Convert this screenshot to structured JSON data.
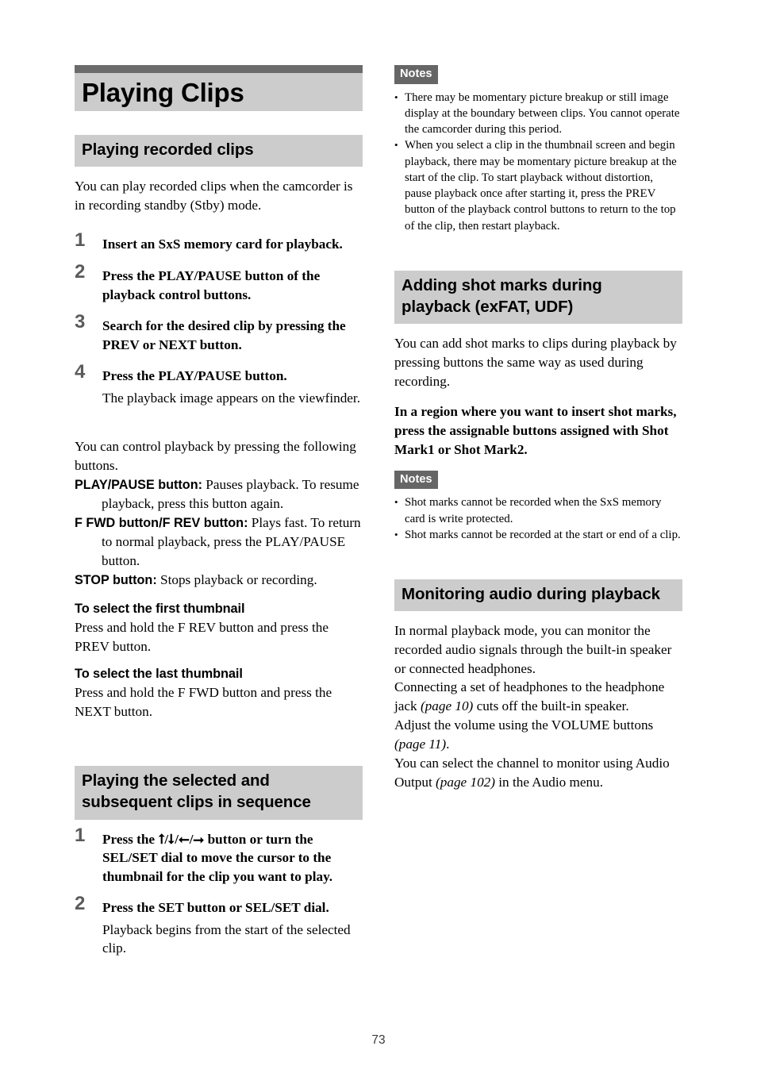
{
  "document": {
    "page_number": "73"
  },
  "chapter": {
    "title": "Playing Clips"
  },
  "left_column": {
    "section1": {
      "heading": "Playing recorded clips",
      "intro": "You can play recorded clips when the camcorder is in recording standby (Stby) mode.",
      "steps": [
        {
          "number": "1",
          "title": "Insert an SxS memory card for playback.",
          "detail": ""
        },
        {
          "number": "2",
          "title": "Press the PLAY/PAUSE button of the playback control buttons.",
          "detail": ""
        },
        {
          "number": "3",
          "title": "Search for the desired clip by pressing the PREV or NEXT button.",
          "detail": ""
        },
        {
          "number": "4",
          "title": "Press the PLAY/PAUSE button.",
          "detail": "The playback image appears on the viewfinder."
        }
      ],
      "control_intro": "You can control playback by pressing the following buttons.",
      "controls": [
        {
          "term": "PLAY/PAUSE button:",
          "desc": " Pauses playback. To resume playback, press this button again."
        },
        {
          "term": "F FWD button/F REV button:",
          "desc": " Plays fast. To return to normal playback, press the PLAY/PAUSE button."
        },
        {
          "term": "STOP button:",
          "desc": " Stops playback or recording."
        }
      ],
      "subheads": [
        {
          "title": "To select the first thumbnail",
          "body": "Press and hold the F REV button and press the PREV button."
        },
        {
          "title": "To select the last thumbnail",
          "body": "Press and hold the F FWD button and press the NEXT button."
        }
      ]
    },
    "section2": {
      "heading": "Playing the selected and subsequent clips in sequence",
      "steps": [
        {
          "number": "1",
          "title": "Press the ⭡/⭣/⭠/⭢ button or turn the SEL/SET dial to move the cursor to the thumbnail for the clip you want to play.",
          "detail": ""
        },
        {
          "number": "2",
          "title": "Press the SET button or SEL/SET dial.",
          "detail": "Playback begins from the start of the selected clip."
        }
      ]
    }
  },
  "right_column": {
    "notes1": {
      "badge": "Notes",
      "items": [
        "There may be momentary picture breakup or still image display at the boundary between clips. You cannot operate the camcorder during this period.",
        "When you select a clip in the thumbnail screen and begin playback, there may be momentary picture breakup at the start of the clip. To start playback without distortion, pause playback once after starting it, press the PREV button of the playback control buttons to return to the top of the clip, then restart playback."
      ]
    },
    "section3": {
      "heading": "Adding shot marks during playback (exFAT, UDF)",
      "intro": "You can add shot marks to clips during playback by pressing buttons the same way as used during recording.",
      "instruction": "In a region where you want to insert shot marks, press the assignable buttons assigned with Shot Mark1 or Shot Mark2."
    },
    "notes2": {
      "badge": "Notes",
      "items": [
        "Shot marks cannot be recorded when the SxS memory card is write protected.",
        "Shot marks cannot be recorded at the start or end of a clip."
      ]
    },
    "section4": {
      "heading": "Monitoring audio during playback",
      "para1": "In normal playback mode, you can monitor the recorded audio signals through the built-in speaker or connected headphones.",
      "para2_a": "Connecting a set of headphones to the headphone jack ",
      "para2_ref": "(page 10)",
      "para2_b": " cuts off the built-in speaker.",
      "para3_a": "Adjust the volume using the VOLUME buttons ",
      "para3_ref": "(page 11)",
      "para3_b": ".",
      "para4_a": "You can select the channel to monitor using Audio Output ",
      "para4_ref": "(page 102)",
      "para4_b": " in the Audio menu."
    }
  },
  "colors": {
    "band_gray": "#cccccc",
    "rule_gray": "#6b6b6b",
    "badge_gray": "#666666",
    "step_number_gray": "#5a5a5a"
  }
}
